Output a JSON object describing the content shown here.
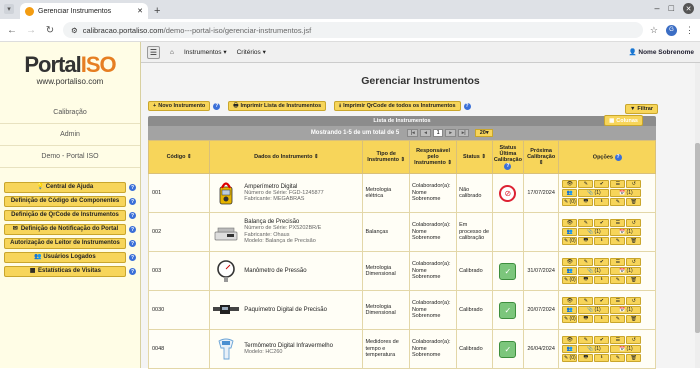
{
  "browser": {
    "tab_title": "Gerenciar Instrumentos",
    "url_host": "calibracao.portaliso.com",
    "url_path": "/demo---portal-iso/gerenciar-instrumentos.jsf",
    "profile_initial": "G"
  },
  "sidebar": {
    "logo_main": "Portal",
    "logo_accent": "ISO",
    "logo_url": "www.portaliso.com",
    "sections": [
      "Calibração",
      "Admin",
      "Demo - Portal ISO"
    ],
    "items": [
      {
        "label": "Central de Ajuda",
        "icon": "bulb-icon"
      },
      {
        "label": "Definição de Código de Componentes",
        "icon": ""
      },
      {
        "label": "Definição de QrCode de Instrumentos",
        "icon": ""
      },
      {
        "label": "Definição de Notificação do Portal",
        "icon": "envelope-icon"
      },
      {
        "label": "Autorização de Leitor de Instrumentos",
        "icon": ""
      },
      {
        "label": "Usuários Logados",
        "icon": "users-icon"
      },
      {
        "label": "Estatísticas de Visitas",
        "icon": "chart-icon"
      }
    ]
  },
  "topnav": {
    "home_icon": "home-icon",
    "menu1": "Instrumentos",
    "menu2": "Critérios",
    "user": "Nome Sobrenome"
  },
  "page": {
    "title": "Gerenciar Instrumentos",
    "btn_new": "Novo Instrumento",
    "btn_print_list": "Imprimir Lista de Instrumentos",
    "btn_print_qr": "Imprimir QrCode de todos os Instrumentos",
    "btn_filter": "Filtrar"
  },
  "table": {
    "panel_title": "Lista de Instrumentos",
    "columns_btn": "Colunas",
    "pager_text": "Mostrando 1-5 de um total de 5",
    "current_page": "1",
    "rows_per_page": "20",
    "headers": {
      "codigo": "Código",
      "dados": "Dados do Instrumento",
      "tipo": "Tipo de Instrumento",
      "resp": "Responsável pelo Instrumento",
      "status": "Status",
      "ultima": "Status Última Calibração",
      "proxima": "Próxima Calibração",
      "opcoes": "Opções"
    },
    "rows": [
      {
        "codigo": "001",
        "nome": "Amperímetro Digital",
        "sub1": "Número de Série: FGD-1245877",
        "sub2": "Fabricante: MEGABRAS",
        "tipo": "Metrologia elétrica",
        "resp": "Colaborador(a): Nome Sobrenome",
        "status": "Não calibrado",
        "ultima": "no",
        "proxima": "17/07/2024",
        "thumb": "clamp-meter"
      },
      {
        "codigo": "002",
        "nome": "Balança de Precisão",
        "sub1": "Número de Série: PX5202BR/E",
        "sub2": "Fabricante: Ohaus",
        "sub3": "Modelo: Balança de Precisão",
        "tipo": "Balanças",
        "resp": "Colaborador(a): Nome Sobrenome",
        "status": "Em processo de calibração",
        "ultima": "",
        "proxima": "",
        "thumb": "scale"
      },
      {
        "codigo": "003",
        "nome": "Manômetro de Pressão",
        "sub1": "",
        "sub2": "",
        "tipo": "Metrologia Dimensional",
        "resp": "Colaborador(a): Nome Sobrenome",
        "status": "Calibrado",
        "ultima": "ok",
        "proxima": "31/07/2024",
        "thumb": "gauge"
      },
      {
        "codigo": "0030",
        "nome": "Paquímetro Digital de Precisão",
        "sub1": "",
        "sub2": "",
        "tipo": "Metrologia Dimensional",
        "resp": "Colaborador(a): Nome Sobrenome",
        "status": "Calibrado",
        "ultima": "ok",
        "proxima": "20/07/2024",
        "thumb": "caliper"
      },
      {
        "codigo": "0048",
        "nome": "Termômetro Digital Infravermelho",
        "sub1": "Modelo: HC260",
        "sub2": "",
        "tipo": "Medidores de tempo e temperatura",
        "resp": "Colaborador(a): Nome Sobrenome",
        "status": "Calibrado",
        "ultima": "ok",
        "proxima": "26/04/2024",
        "thumb": "thermometer"
      }
    ],
    "op_counts": [
      "(1)",
      "(1)",
      "(1)",
      "(0)"
    ]
  },
  "colors": {
    "accent": "#f7d55a",
    "accent_border": "#c9a62c",
    "brand_orange": "#e67e22"
  }
}
